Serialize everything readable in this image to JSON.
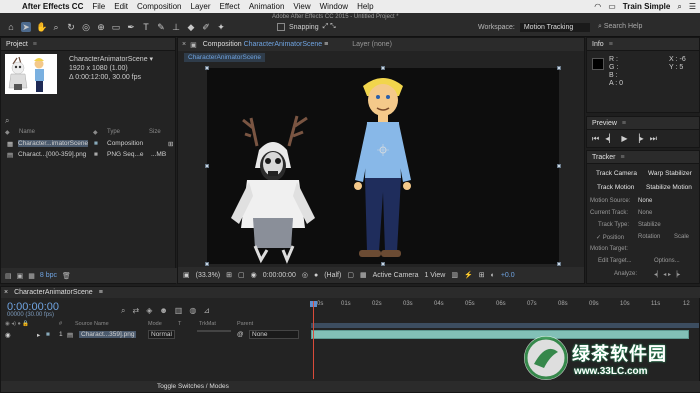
{
  "menubar": {
    "apple": "",
    "app_name": "After Effects CC",
    "items": [
      "File",
      "Edit",
      "Composition",
      "Layer",
      "Effect",
      "Animation",
      "View",
      "Window",
      "Help"
    ],
    "user": "Train Simple"
  },
  "toolbar": {
    "window_title": "Adobe After Effects CC 2015 - Untitled Project *",
    "snapping_label": "Snapping",
    "workspace_label": "Workspace:",
    "workspace_value": "Motion Tracking",
    "search_help": "Search Help"
  },
  "project": {
    "title": "Project",
    "selected_name": "CharacterAnimatorScene ▾",
    "selected_dims": "1920 x 1080 (1.00)",
    "selected_duration": "Δ 0:00:12:00, 30.00 fps",
    "columns": {
      "name": "Name",
      "type": "Type",
      "size": "Size"
    },
    "items": [
      {
        "name": "Character...imatorScene",
        "type": "Composition",
        "size": ""
      },
      {
        "name": "Charact...[000-359].png",
        "type": "PNG Seq...e",
        "size": "...MB"
      }
    ],
    "bpc": "8 bpc"
  },
  "composition": {
    "tab_prefix": "Composition",
    "tab_name": "CharacterAnimatorScene",
    "layer_tab": "Layer (none)",
    "sub_tab": "CharacterAnimatorScene",
    "zoom": "(33.3%)",
    "timecode": "0:00:00:00",
    "resolution": "(Half)",
    "camera": "Active Camera",
    "views": "1 View",
    "exposure": "+0.0"
  },
  "info": {
    "title": "Info",
    "r": "R :",
    "g": "G :",
    "b": "B :",
    "a": "A : 0",
    "x": "X : -6",
    "y": "Y : 5"
  },
  "preview": {
    "title": "Preview"
  },
  "tracker": {
    "title": "Tracker",
    "track_camera": "Track Camera",
    "warp_stabilizer": "Warp Stabilizer",
    "track_motion": "Track Motion",
    "stabilize_motion": "Stabilize Motion",
    "motion_source_label": "Motion Source:",
    "motion_source_value": "None",
    "current_track_label": "Current Track:",
    "current_track_value": "None",
    "track_type_label": "Track Type:",
    "track_type_value": "Stabilize",
    "position": "Position",
    "rotation": "Rotation",
    "scale": "Scale",
    "motion_target_label": "Motion Target:",
    "edit_target": "Edit Target...",
    "options": "Options...",
    "analyze_label": "Analyze:"
  },
  "timeline": {
    "tab": "CharacterAnimatorScene",
    "timecode": "0:00:00:00",
    "frames": "00000 (30.00 fps)",
    "columns": {
      "num": "#",
      "source": "Source Name",
      "mode": "Mode",
      "trkmat": "TrkMat",
      "parent": "Parent"
    },
    "layer": {
      "num": "1",
      "source": "Charact...359].png",
      "mode": "Normal",
      "parent": "None"
    },
    "ruler": [
      "0s",
      "01s",
      "02s",
      "03s",
      "04s",
      "05s",
      "06s",
      "07s",
      "08s",
      "09s",
      "10s",
      "11s",
      "12"
    ],
    "toggle": "Toggle Switches / Modes"
  },
  "watermark": {
    "text": "绿茶软件园",
    "url": "www.33LC.com"
  }
}
